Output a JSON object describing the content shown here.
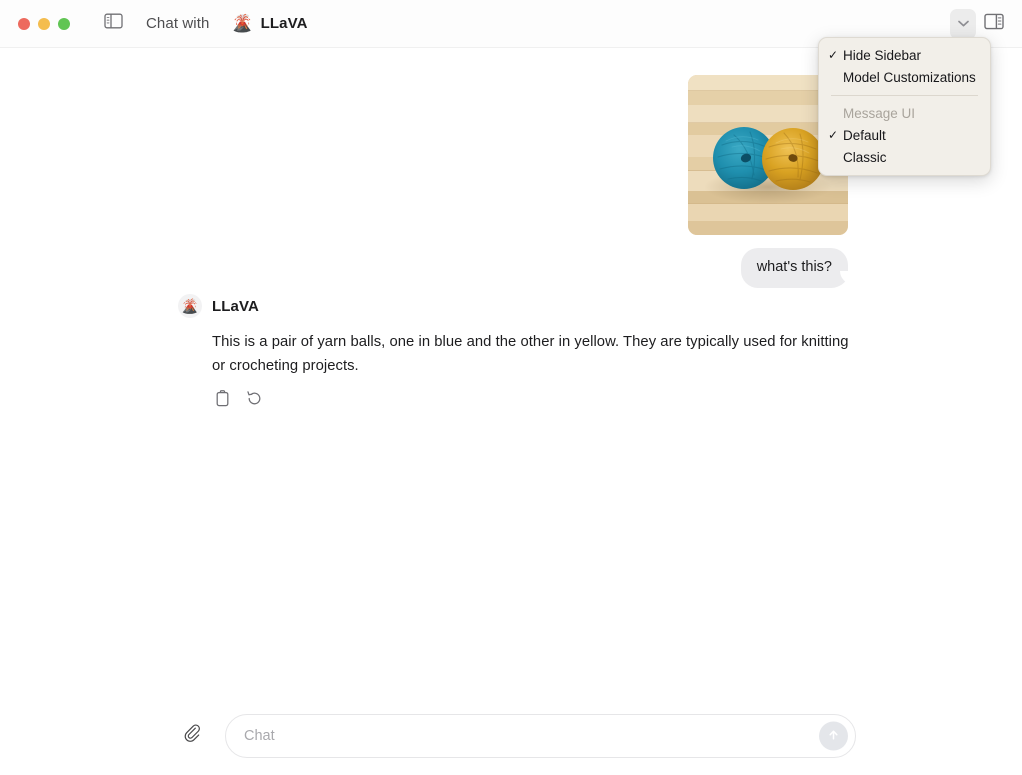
{
  "window": {
    "traffic_lights": [
      {
        "name": "close",
        "color": "#ed6a5e"
      },
      {
        "name": "minimize",
        "color": "#f4bd4f"
      },
      {
        "name": "maximize",
        "color": "#61c554"
      }
    ],
    "title": "Chat with",
    "model_name": "LLaVA",
    "model_icon": "volcano-icon",
    "model_glyph": "🌋",
    "sidebar_toggle_icon": "left-sidebar-panel-icon",
    "chevron_icon": "chevron-down-icon",
    "right_panel_icon": "right-sidebar-panel-icon"
  },
  "dropdown": {
    "visible": true,
    "background": "#f2efe9",
    "items": [
      {
        "label": "Hide Sidebar",
        "checked": true,
        "disabled": false,
        "divider_after": false
      },
      {
        "label": "Model Customizations",
        "checked": false,
        "disabled": false,
        "divider_after": true
      },
      {
        "label": "Message UI",
        "checked": false,
        "disabled": true,
        "divider_after": false
      },
      {
        "label": "Default",
        "checked": true,
        "disabled": false,
        "divider_after": false
      },
      {
        "label": "Classic",
        "checked": false,
        "disabled": false,
        "divider_after": false
      }
    ]
  },
  "conversation": {
    "user_image": {
      "alt": "two yarn balls on wood surface",
      "colors": {
        "yarn_blue": "#1f8fae",
        "yarn_yellow": "#d9a222",
        "wood_light": "#efdcbb",
        "wood_mid": "#e3cfa8",
        "wood_dark": "#d6bd8e"
      }
    },
    "user_message": "what's this?",
    "assistant": {
      "name": "LLaVA",
      "avatar_icon": "volcano-icon",
      "avatar_glyph": "🌋",
      "text": "This is a pair of yarn balls, one in blue and the other in yellow. They are typically used for knitting or crocheting projects.",
      "actions": [
        {
          "name": "copy-icon",
          "label": "Copy"
        },
        {
          "name": "regenerate-icon",
          "label": "Regenerate"
        }
      ]
    }
  },
  "composer": {
    "attach_icon": "paperclip-icon",
    "placeholder": "Chat",
    "value": "",
    "send_icon": "arrow-up-icon",
    "send_enabled": false
  }
}
